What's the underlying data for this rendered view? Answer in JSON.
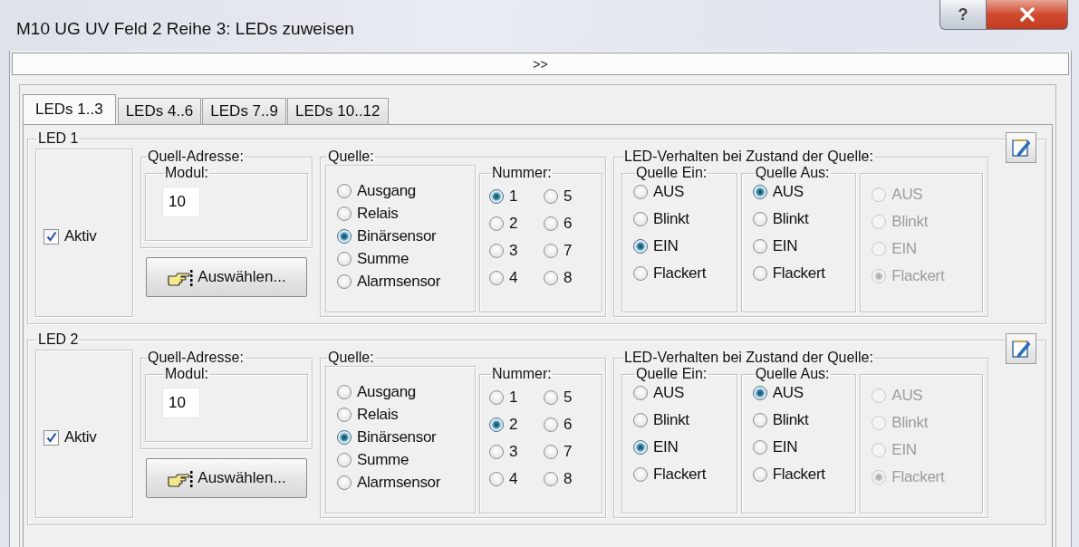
{
  "window": {
    "title": "M10 UG UV Feld 2 Reihe 3: LEDs zuweisen",
    "help_button": "?"
  },
  "expander": ">>",
  "tabs": [
    {
      "label": "LEDs 1..3",
      "selected": true
    },
    {
      "label": "LEDs 4..6",
      "selected": false
    },
    {
      "label": "LEDs 7..9",
      "selected": false
    },
    {
      "label": "LEDs 10..12",
      "selected": false
    }
  ],
  "leds": [
    {
      "title": "LED 1",
      "aktiv": {
        "label": "Aktiv",
        "checked": true
      },
      "address": {
        "title": "Quell-Adresse:",
        "modul": {
          "title": "Modul:",
          "value": "10"
        }
      },
      "select_button": "Auswählen...",
      "source": {
        "title": "Quelle:",
        "options": [
          {
            "label": "Ausgang",
            "selected": false
          },
          {
            "label": "Relais",
            "selected": false
          },
          {
            "label": "Binärsensor",
            "selected": true
          },
          {
            "label": "Summe",
            "selected": false
          },
          {
            "label": "Alarmsensor",
            "selected": false
          }
        ],
        "number": {
          "title": "Nummer:",
          "options": [
            {
              "label": "1",
              "selected": true
            },
            {
              "label": "2",
              "selected": false
            },
            {
              "label": "3",
              "selected": false
            },
            {
              "label": "4",
              "selected": false
            },
            {
              "label": "5",
              "selected": false
            },
            {
              "label": "6",
              "selected": false
            },
            {
              "label": "7",
              "selected": false
            },
            {
              "label": "8",
              "selected": false
            }
          ]
        }
      },
      "behavior": {
        "title": "LED-Verhalten bei Zustand der Quelle:",
        "groups": [
          {
            "title": "Quelle Ein:",
            "disabled": false,
            "options": [
              {
                "label": "AUS",
                "selected": false
              },
              {
                "label": "Blinkt",
                "selected": false
              },
              {
                "label": "EIN",
                "selected": true
              },
              {
                "label": "Flackert",
                "selected": false
              }
            ]
          },
          {
            "title": "Quelle Aus:",
            "disabled": false,
            "options": [
              {
                "label": "AUS",
                "selected": true
              },
              {
                "label": "Blinkt",
                "selected": false
              },
              {
                "label": "EIN",
                "selected": false
              },
              {
                "label": "Flackert",
                "selected": false
              }
            ]
          },
          {
            "disabled": true,
            "options": [
              {
                "label": "AUS",
                "selected": false
              },
              {
                "label": "Blinkt",
                "selected": false
              },
              {
                "label": "EIN",
                "selected": false
              },
              {
                "label": "Flackert",
                "selected": true
              }
            ]
          }
        ]
      }
    },
    {
      "title": "LED 2",
      "aktiv": {
        "label": "Aktiv",
        "checked": true
      },
      "address": {
        "title": "Quell-Adresse:",
        "modul": {
          "title": "Modul:",
          "value": "10"
        }
      },
      "select_button": "Auswählen...",
      "source": {
        "title": "Quelle:",
        "options": [
          {
            "label": "Ausgang",
            "selected": false
          },
          {
            "label": "Relais",
            "selected": false
          },
          {
            "label": "Binärsensor",
            "selected": true
          },
          {
            "label": "Summe",
            "selected": false
          },
          {
            "label": "Alarmsensor",
            "selected": false
          }
        ],
        "number": {
          "title": "Nummer:",
          "options": [
            {
              "label": "1",
              "selected": false
            },
            {
              "label": "2",
              "selected": true
            },
            {
              "label": "3",
              "selected": false
            },
            {
              "label": "4",
              "selected": false
            },
            {
              "label": "5",
              "selected": false
            },
            {
              "label": "6",
              "selected": false
            },
            {
              "label": "7",
              "selected": false
            },
            {
              "label": "8",
              "selected": false
            }
          ]
        }
      },
      "behavior": {
        "title": "LED-Verhalten bei Zustand der Quelle:",
        "groups": [
          {
            "title": "Quelle Ein:",
            "disabled": false,
            "options": [
              {
                "label": "AUS",
                "selected": false
              },
              {
                "label": "Blinkt",
                "selected": false
              },
              {
                "label": "EIN",
                "selected": true
              },
              {
                "label": "Flackert",
                "selected": false
              }
            ]
          },
          {
            "title": "Quelle Aus:",
            "disabled": false,
            "options": [
              {
                "label": "AUS",
                "selected": true
              },
              {
                "label": "Blinkt",
                "selected": false
              },
              {
                "label": "EIN",
                "selected": false
              },
              {
                "label": "Flackert",
                "selected": false
              }
            ]
          },
          {
            "disabled": true,
            "options": [
              {
                "label": "AUS",
                "selected": false
              },
              {
                "label": "Blinkt",
                "selected": false
              },
              {
                "label": "EIN",
                "selected": false
              },
              {
                "label": "Flackert",
                "selected": true
              }
            ]
          }
        ]
      }
    }
  ]
}
